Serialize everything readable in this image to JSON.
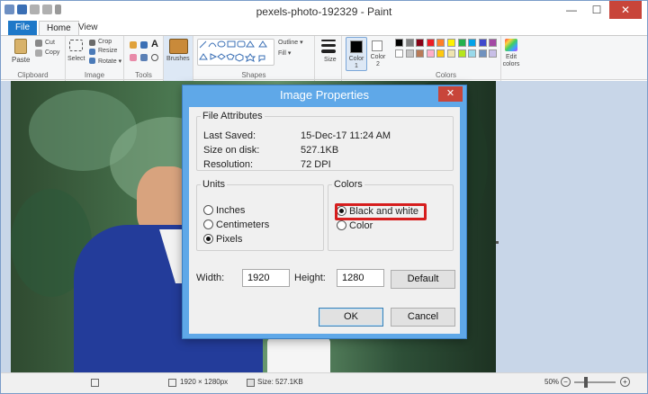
{
  "window": {
    "title": "pexels-photo-192329 - Paint",
    "min": "—",
    "max": "☐",
    "close": "✕"
  },
  "tabs": {
    "file": "File",
    "home": "Home",
    "view": "View"
  },
  "ribbon": {
    "clipboard": {
      "paste": "Paste",
      "cut": "Cut",
      "copy": "Copy",
      "label": "Clipboard"
    },
    "image": {
      "select": "Select",
      "crop": "Crop",
      "resize": "Resize",
      "rotate": "Rotate ▾",
      "label": "Image"
    },
    "tools": {
      "label": "Tools"
    },
    "brushes": "Brushes",
    "shapes": {
      "outline": "Outline ▾",
      "fill": "Fill ▾",
      "label": "Shapes"
    },
    "size": "Size",
    "color1": "Color 1",
    "color2": "Color 2",
    "colors_label": "Colors",
    "edit_colors": "Edit colors",
    "palette_row1": [
      "#000000",
      "#7f7f7f",
      "#880015",
      "#ed1c24",
      "#ff7f27",
      "#fff200",
      "#22b14c",
      "#00a2e8",
      "#3f48cc",
      "#a349a4"
    ],
    "palette_row2": [
      "#ffffff",
      "#c3c3c3",
      "#b97a57",
      "#ffaec9",
      "#ffc90e",
      "#efe4b0",
      "#b5e61d",
      "#99d9ea",
      "#7092be",
      "#c8bfe7"
    ]
  },
  "status": {
    "dims": "1920 × 1280px",
    "size": "Size: 527.1KB",
    "zoom": "50%"
  },
  "dialog": {
    "title": "Image Properties",
    "close": "✕",
    "file_attributes": {
      "legend": "File Attributes",
      "rows": [
        {
          "label": "Last Saved:",
          "value": "15-Dec-17 11:24 AM"
        },
        {
          "label": "Size on disk:",
          "value": "527.1KB"
        },
        {
          "label": "Resolution:",
          "value": "72 DPI"
        }
      ]
    },
    "units": {
      "legend": "Units",
      "options": [
        "Inches",
        "Centimeters",
        "Pixels"
      ],
      "selected": "Pixels"
    },
    "colors": {
      "legend": "Colors",
      "options": [
        "Black and white",
        "Color"
      ],
      "selected": "Black and white"
    },
    "width_label": "Width:",
    "width_value": "1920",
    "height_label": "Height:",
    "height_value": "1280",
    "default_button": "Default",
    "ok_button": "OK",
    "cancel_button": "Cancel"
  }
}
